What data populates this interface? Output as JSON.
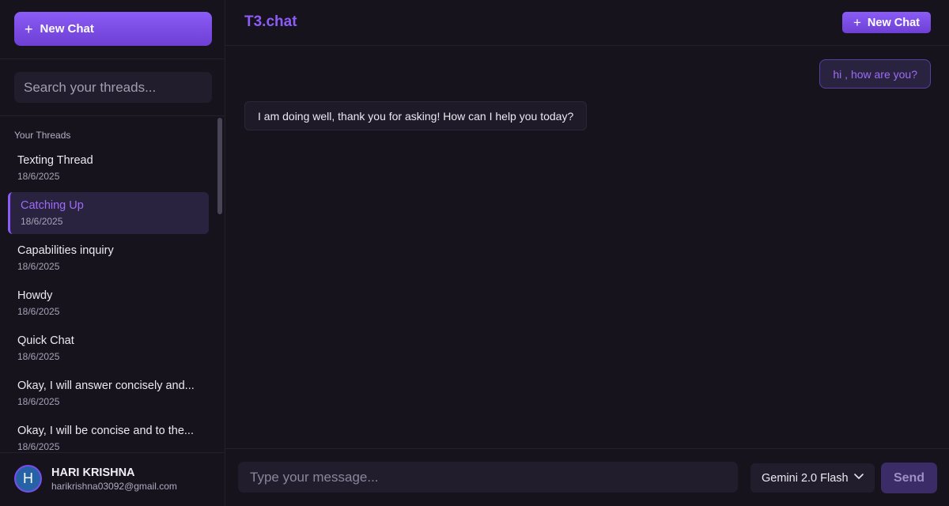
{
  "sidebar": {
    "new_chat_label": "New Chat",
    "search_placeholder": "Search your threads...",
    "threads_heading": "Your Threads",
    "threads": [
      {
        "title": "Texting Thread",
        "date": "18/6/2025"
      },
      {
        "title": "Catching Up",
        "date": "18/6/2025",
        "active": true
      },
      {
        "title": "Capabilities inquiry",
        "date": "18/6/2025"
      },
      {
        "title": "Howdy",
        "date": "18/6/2025"
      },
      {
        "title": "Quick Chat",
        "date": "18/6/2025"
      },
      {
        "title": "Okay, I will answer concisely and...",
        "date": "18/6/2025"
      },
      {
        "title": "Okay, I will be concise and to the...",
        "date": "18/6/2025"
      }
    ],
    "user": {
      "avatar_letter": "H",
      "name": "HARI KRISHNA",
      "email": "harikrishna03092@gmail.com"
    }
  },
  "header": {
    "brand": "T3.chat",
    "new_chat_label": "New Chat"
  },
  "messages": [
    {
      "role": "user",
      "text": "hi , how are you?"
    },
    {
      "role": "assistant",
      "text": "I am doing well, thank you for asking! How can I help you today?"
    }
  ],
  "composer": {
    "placeholder": "Type your message...",
    "model": "Gemini 2.0 Flash",
    "send_label": "Send"
  },
  "colors": {
    "accent": "#8b5cf6",
    "background": "#16131d",
    "panel": "#221d2d"
  }
}
